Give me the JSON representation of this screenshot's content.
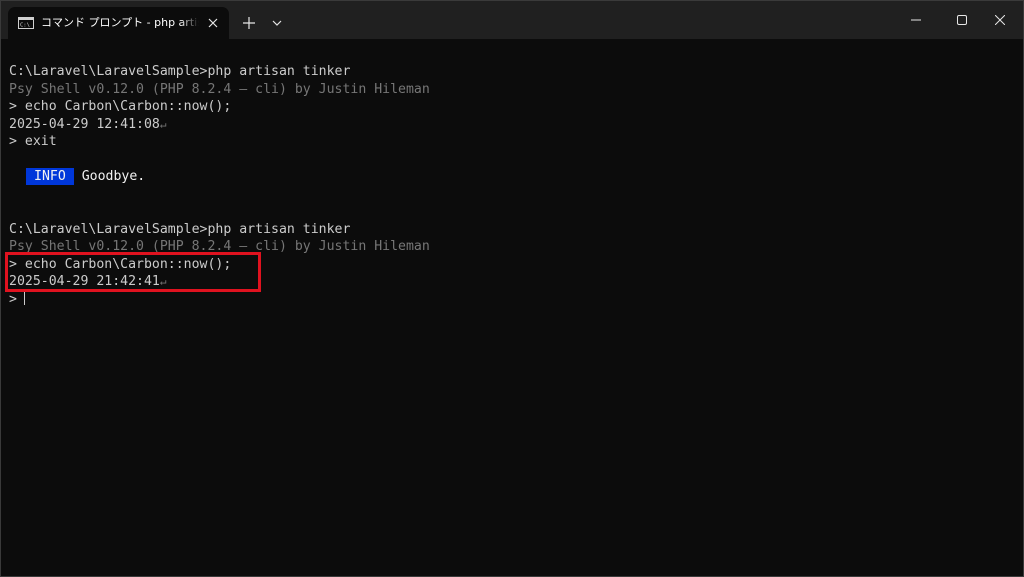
{
  "window": {
    "tab_title": "コマンド プロンプト - php  artisan tinker",
    "tab_icon": "cmd-icon",
    "new_tab_icon": "plus-icon",
    "dropdown_icon": "chevron-down-icon",
    "controls": [
      "minimize-icon",
      "maximize-icon",
      "close-icon"
    ]
  },
  "terminal": {
    "lines": [
      {
        "text": "C:\\Laravel\\LaravelSample>php artisan tinker",
        "style": "normal"
      },
      {
        "text": "Psy Shell v0.12.0 (PHP 8.2.4 — cli) by Justin Hileman",
        "style": "dim"
      },
      {
        "text": "> echo Carbon\\Carbon::now();",
        "style": "normal"
      },
      {
        "text": "2025-04-29 12:41:08",
        "return_mark": "↵",
        "style": "normal"
      },
      {
        "text": "> exit",
        "style": "normal"
      },
      {
        "text": "",
        "style": "blank"
      },
      {
        "badge": "INFO",
        "text": "Goodbye.",
        "style": "info"
      },
      {
        "text": "",
        "style": "blank"
      },
      {
        "text": "",
        "style": "blank"
      },
      {
        "text": "C:\\Laravel\\LaravelSample>php artisan tinker",
        "style": "normal"
      },
      {
        "text": "Psy Shell v0.12.0 (PHP 8.2.4 — cli) by Justin Hileman",
        "style": "dim"
      },
      {
        "text": "> echo Carbon\\Carbon::now();",
        "style": "normal"
      },
      {
        "text": "2025-04-29 21:42:41",
        "return_mark": "↵",
        "style": "normal"
      },
      {
        "text": ">",
        "style": "prompt"
      }
    ]
  },
  "colors": {
    "background": "#0c0c0c",
    "titlebar": "#202020",
    "text": "#cccccc",
    "dim_text": "#767676",
    "info_badge": "#0037da",
    "highlight": "#e0121f"
  }
}
